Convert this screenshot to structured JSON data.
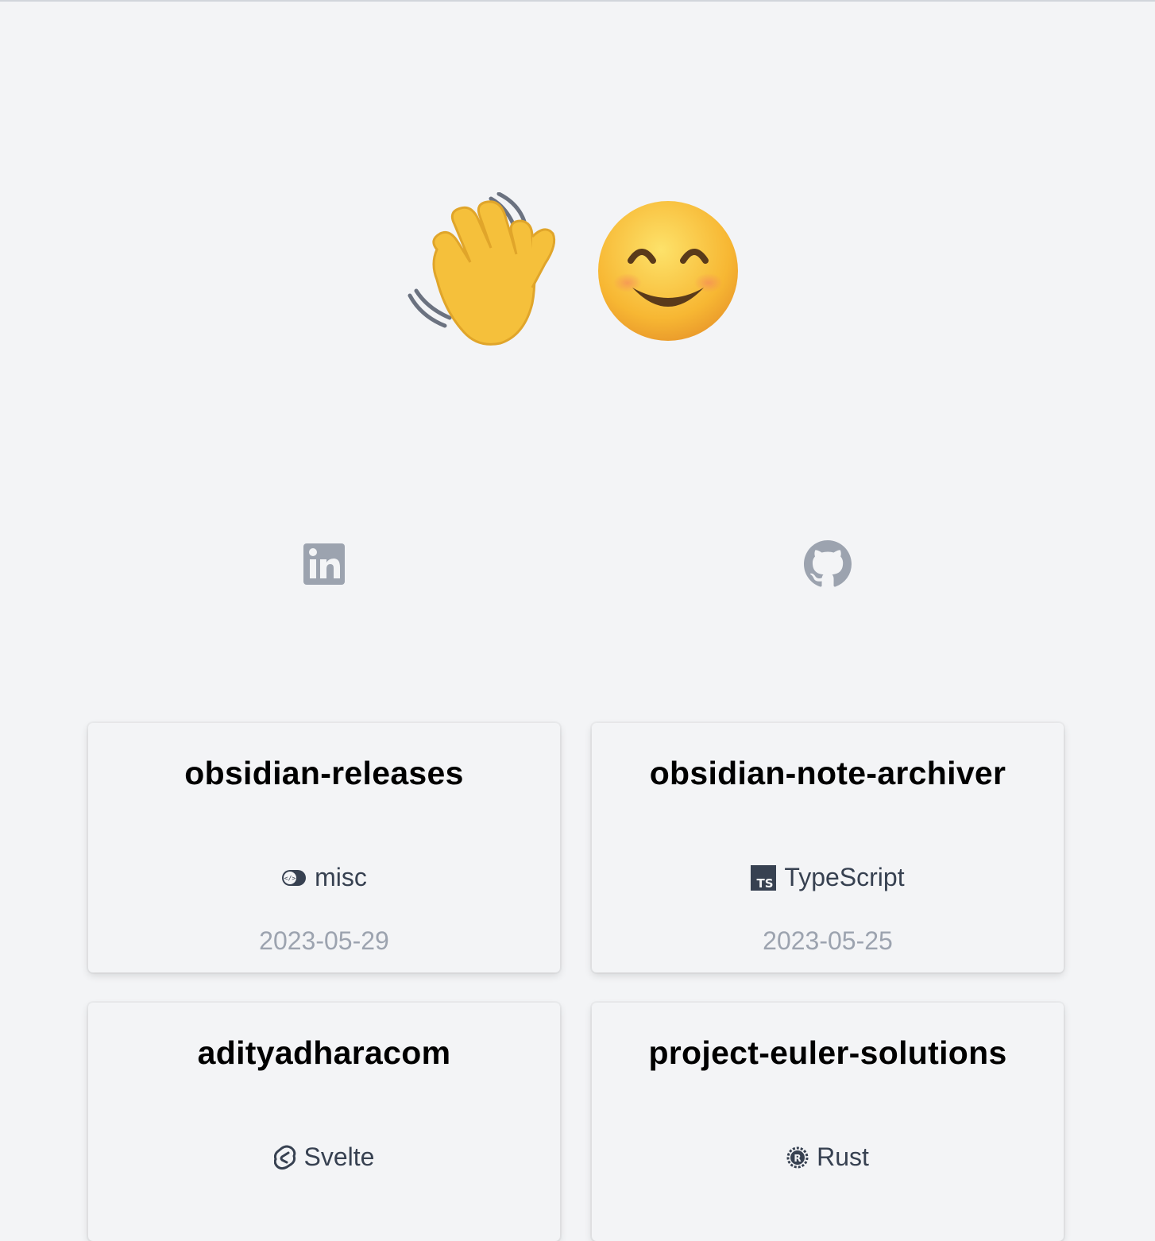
{
  "hero": {
    "wave_icon": "waving-hand-emoji",
    "smile_icon": "smiling-face-emoji"
  },
  "social": {
    "linkedin_icon": "linkedin-icon",
    "github_icon": "github-icon"
  },
  "colors": {
    "background": "#f3f4f6",
    "icon_gray": "#9ca3af",
    "date_gray": "#9ca3af",
    "lang_text": "#374151"
  },
  "projects": [
    {
      "title": "obsidian-releases",
      "language": "misc",
      "language_icon": "misc-toggle-icon",
      "date": "2023-05-29"
    },
    {
      "title": "obsidian-note-archiver",
      "language": "TypeScript",
      "language_icon": "typescript-icon",
      "date": "2023-05-25"
    },
    {
      "title": "adityadharacom",
      "language": "Svelte",
      "language_icon": "svelte-icon",
      "date": ""
    },
    {
      "title": "project-euler-solutions",
      "language": "Rust",
      "language_icon": "rust-icon",
      "date": ""
    }
  ]
}
